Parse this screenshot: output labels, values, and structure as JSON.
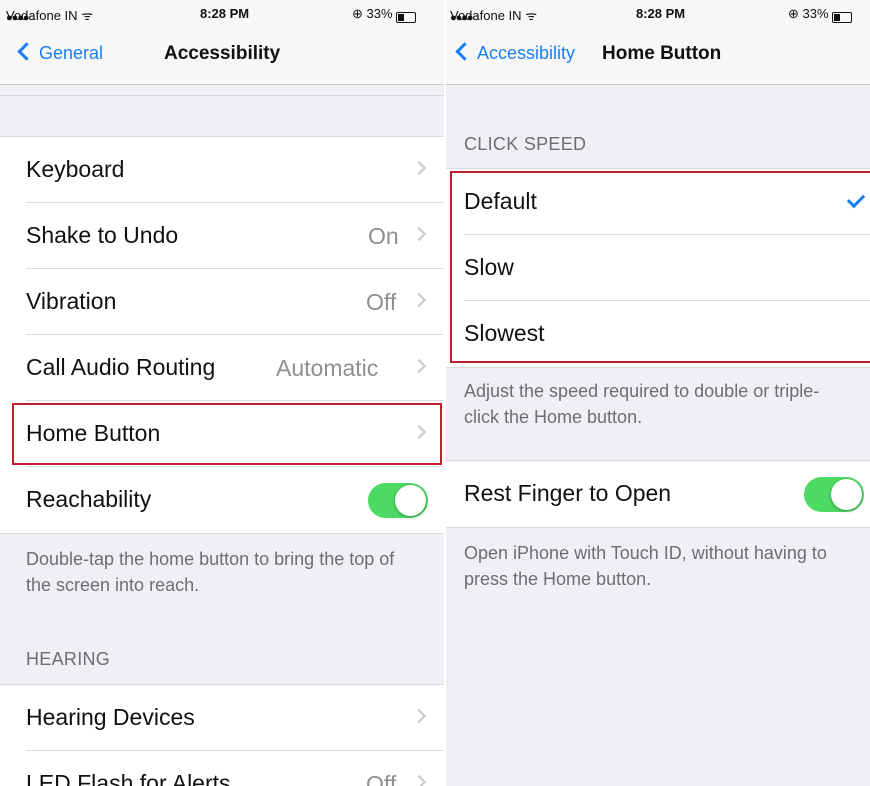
{
  "left": {
    "status": {
      "carrier": "Vodafone IN",
      "time": "8:28 PM",
      "battery": "33%"
    },
    "nav": {
      "back": "General",
      "title": "Accessibility"
    },
    "rows": [
      {
        "label": "Keyboard",
        "value": ""
      },
      {
        "label": "Shake to Undo",
        "value": "On"
      },
      {
        "label": "Vibration",
        "value": "Off"
      },
      {
        "label": "Call Audio Routing",
        "value": "Automatic"
      },
      {
        "label": "Home Button",
        "value": ""
      },
      {
        "label": "Reachability",
        "value": ""
      }
    ],
    "reachability_on": true,
    "note": "Double-tap the home button to bring the top of the screen into reach.",
    "hearing_header": "HEARING",
    "hearing_rows": [
      {
        "label": "Hearing Devices",
        "value": ""
      },
      {
        "label": "LED Flash for Alerts",
        "value": "Off"
      }
    ]
  },
  "right": {
    "status": {
      "carrier": "Vodafone IN",
      "time": "8:28 PM",
      "battery": "33%"
    },
    "nav": {
      "back": "Accessibility",
      "title": "Home Button"
    },
    "click_speed_header": "CLICK SPEED",
    "options": [
      "Default",
      "Slow",
      "Slowest"
    ],
    "selected": "Default",
    "note": "Adjust the speed required to double or triple-click the Home button.",
    "rest_finger_label": "Rest Finger to Open",
    "rest_finger_on": true,
    "rest_note": "Open iPhone with Touch ID, without having to press the Home button."
  },
  "colors": {
    "accent": "#1a7ef5",
    "toggle_on": "#4cd964",
    "highlight": "#c21e2e"
  }
}
